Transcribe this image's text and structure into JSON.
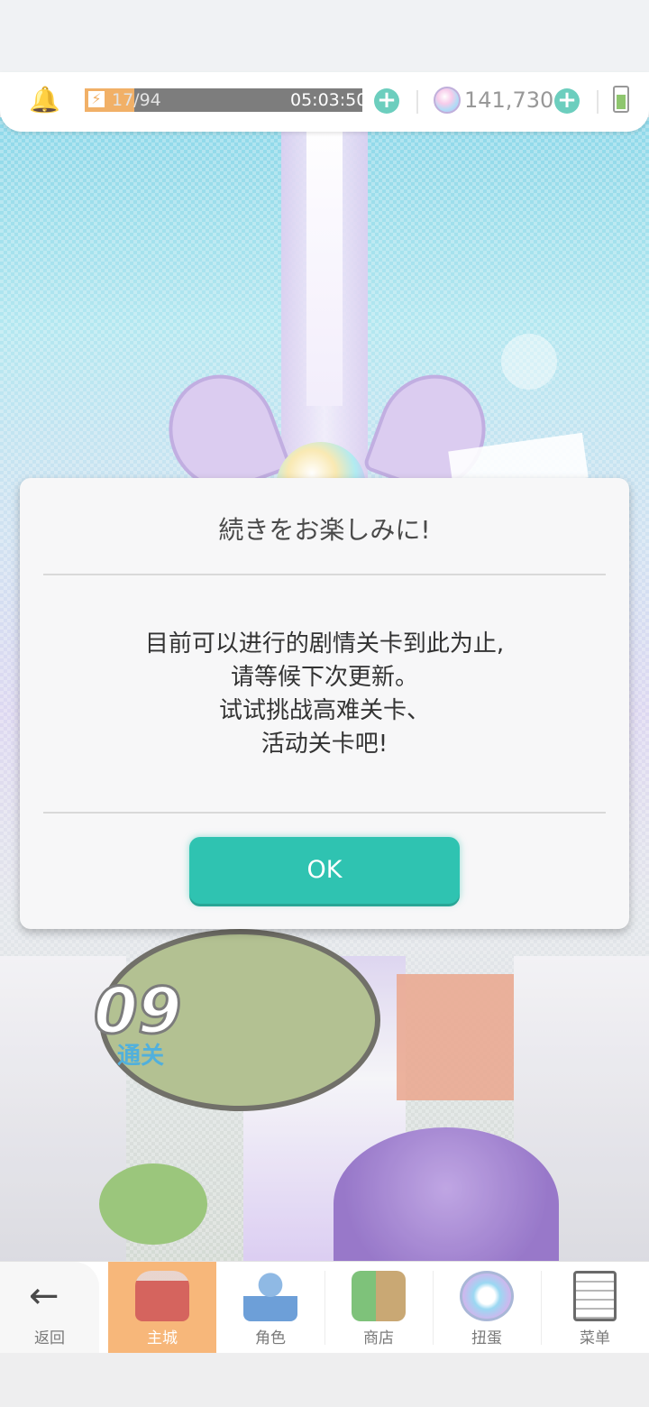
{
  "status_bar": {
    "stamina_current": "17",
    "stamina_text": "17/94",
    "stamina_fraction": 0.18,
    "timer": "05:03:50",
    "gem_count": "141,730"
  },
  "scene": {
    "level_number": "09",
    "level_subtitle": "通关"
  },
  "dialog": {
    "title": "続きをお楽しみに!",
    "body_lines": [
      "目前可以进行的剧情关卡到此为止,",
      "请等候下次更新。",
      "试试挑战高难关卡、",
      "活动关卡吧!"
    ],
    "ok_label": "OK"
  },
  "bottom_nav": {
    "items": [
      {
        "label": "返回",
        "icon": "back-arrow-icon"
      },
      {
        "label": "主城",
        "icon": "castle-icon",
        "active": true
      },
      {
        "label": "角色",
        "icon": "character-icon"
      },
      {
        "label": "商店",
        "icon": "shop-icon"
      },
      {
        "label": "扭蛋",
        "icon": "gacha-icon"
      },
      {
        "label": "菜单",
        "icon": "menu-icon"
      }
    ]
  },
  "colors": {
    "accent": "#2fc3b1",
    "nav_active": "#f7b77a",
    "stamina": "#f0a552"
  }
}
